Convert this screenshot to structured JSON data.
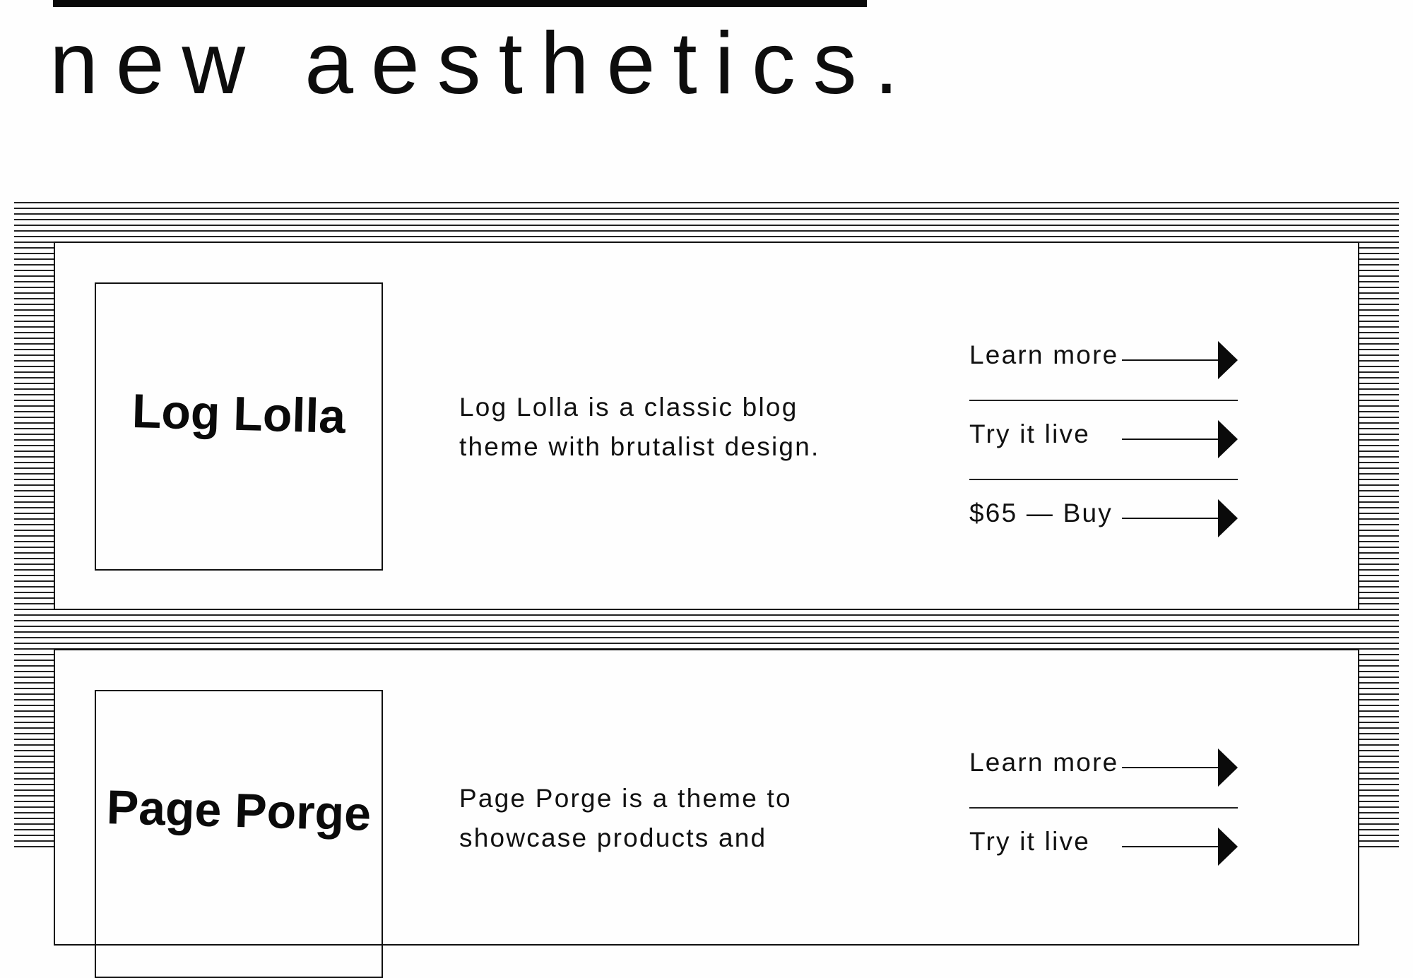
{
  "headline": "new aesthetics.",
  "products": [
    {
      "logo_text": "Log Lolla",
      "description": "Log Lolla is a classic blog theme with brutalist design.",
      "actions": [
        {
          "label": "Learn more",
          "icon": "arrow-right-icon"
        },
        {
          "label": "Try it live",
          "icon": "arrow-right-icon"
        },
        {
          "label": "$65 — Buy",
          "icon": "arrow-right-icon"
        }
      ]
    },
    {
      "logo_text": "Page Porge",
      "description": "Page Porge is a theme to showcase products and",
      "actions": [
        {
          "label": "Learn more",
          "icon": "arrow-right-icon"
        },
        {
          "label": "Try it live",
          "icon": "arrow-right-icon"
        }
      ]
    }
  ],
  "colors": {
    "ink": "#111111",
    "background": "#fefefe"
  }
}
